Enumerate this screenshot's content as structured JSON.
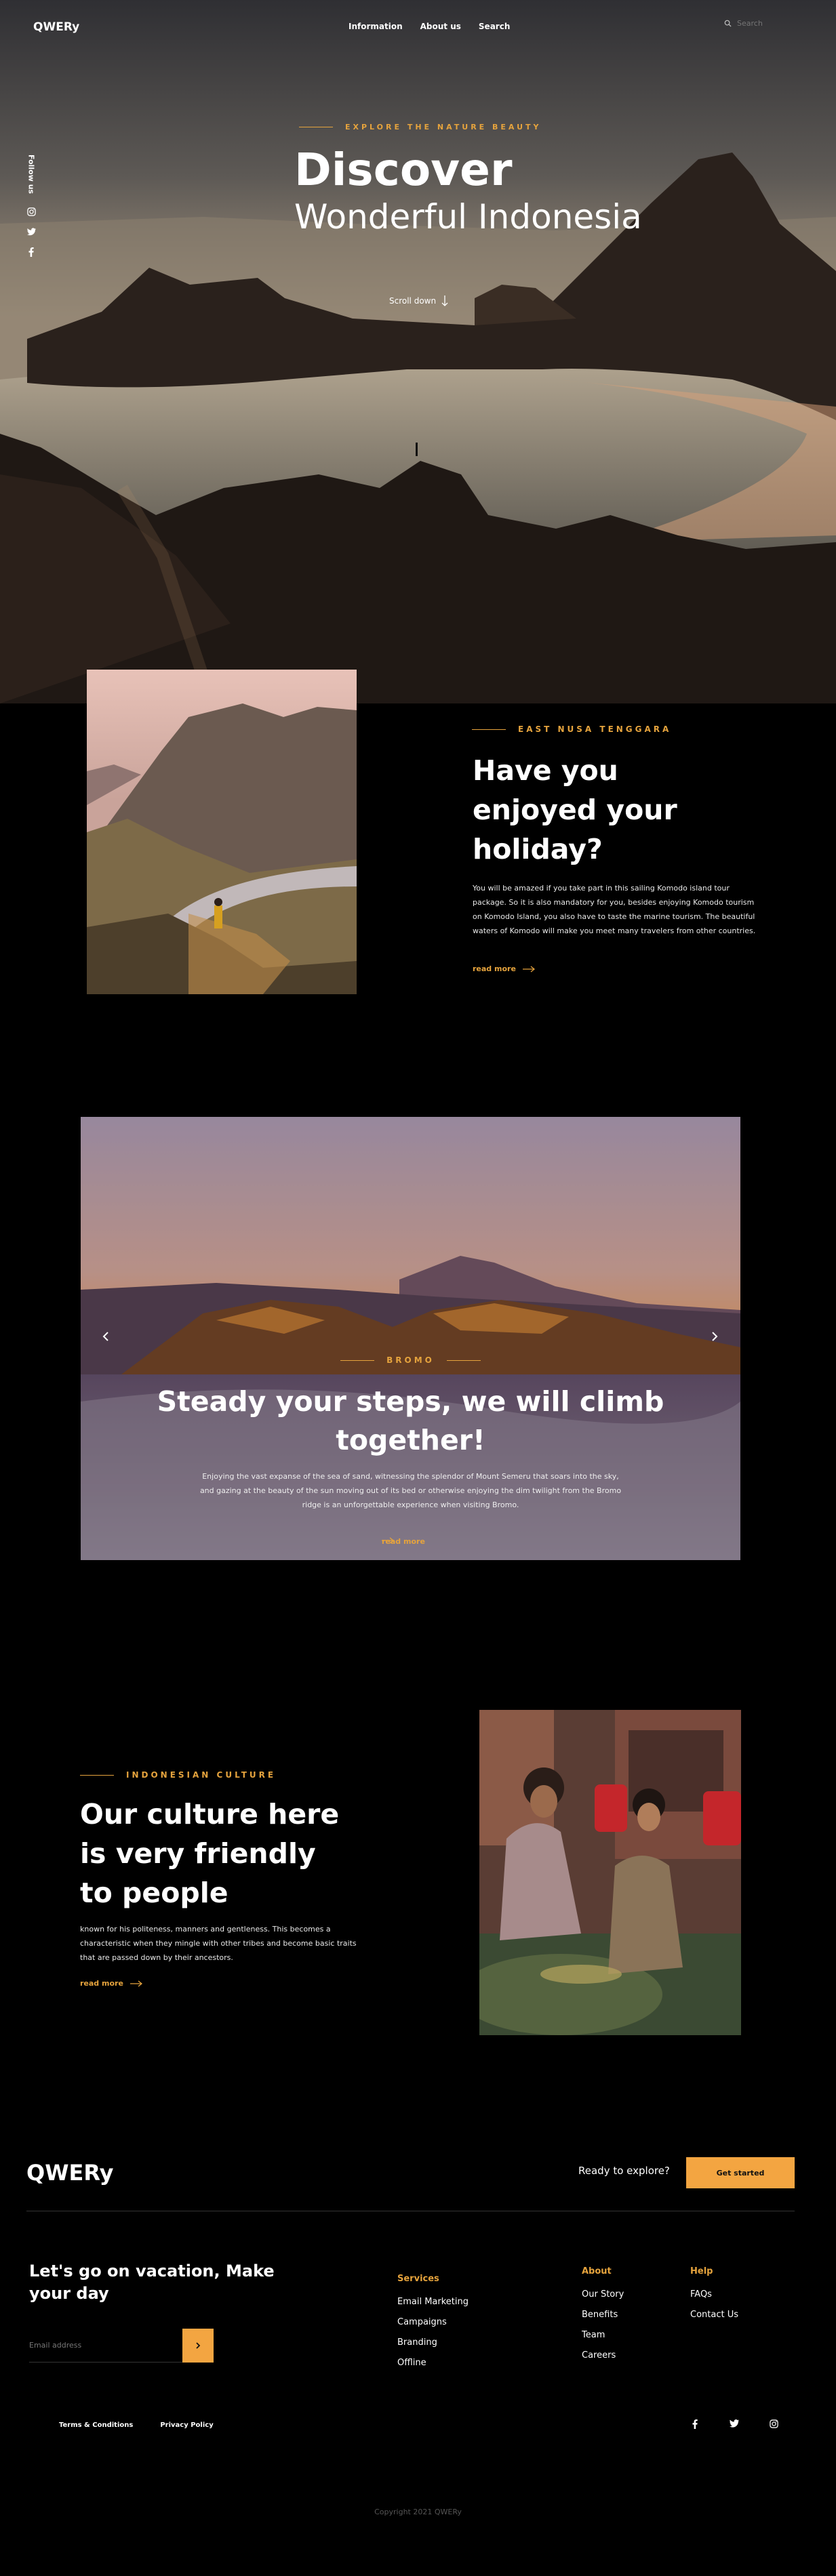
{
  "nav": {
    "logo": "QWERy",
    "links": [
      "Information",
      "About us",
      "Search"
    ],
    "search_placeholder": "Search"
  },
  "hero": {
    "follow_label": "Follow us",
    "socials": [
      "instagram-icon",
      "twitter-icon",
      "facebook-icon"
    ],
    "eyebrow": "EXPLORE THE NATURE BEAUTY",
    "title_line1": "Discover",
    "title_line2": "Wonderful Indonesia",
    "scroll_label": "Scroll down"
  },
  "section_ntt": {
    "eyebrow": "EAST NUSA TENGGARA",
    "title": "Have you enjoyed your holiday?",
    "text": "You will be amazed if you take part in this sailing Komodo island tour package. So it is also mandatory for you, besides enjoying Komodo tourism on Komodo Island, you also have to taste the marine tourism. The beautiful waters of Komodo will make you meet many travelers from other countries.",
    "read_more": "read more"
  },
  "section_bromo": {
    "eyebrow": "BROMO",
    "title": "Steady your steps, we will climb together!",
    "text": "Enjoying the vast expanse of the sea of sand, witnessing the splendor of Mount Semeru that soars into the sky, and gazing at the beauty of the sun moving out of its bed or otherwise enjoying the dim twilight from the Bromo ridge is an unforgettable experience when visiting Bromo.",
    "read_more": "read more"
  },
  "section_culture": {
    "eyebrow": "INDONESIAN CULTURE",
    "title": "Our culture here is very friendly to people",
    "text": "known for his politeness, manners and gentleness. This becomes a characteristic when they mingle with other tribes and become basic traits that are passed down by their ancestors.",
    "read_more": "read more"
  },
  "footer": {
    "logo": "QWERy",
    "ready": "Ready to explore?",
    "cta": "Get started",
    "tagline": "Let's go on vacation, Make your day",
    "email_placeholder": "Email address",
    "columns": [
      {
        "title": "Services",
        "links": [
          "Email Marketing",
          "Campaigns",
          "Branding",
          "Offline"
        ]
      },
      {
        "title": "About",
        "links": [
          "Our Story",
          "Benefits",
          "Team",
          "Careers"
        ]
      },
      {
        "title": "Help",
        "links": [
          "FAQs",
          "Contact Us"
        ]
      }
    ],
    "legal": [
      "Terms & Conditions",
      "Privacy Policy"
    ],
    "socials": [
      "facebook-icon",
      "twitter-icon",
      "instagram-icon"
    ],
    "copyright": "Copyright 2021 QWERy"
  },
  "colors": {
    "accent": "#e5a33d",
    "button": "#f3a541",
    "background": "#000000"
  }
}
